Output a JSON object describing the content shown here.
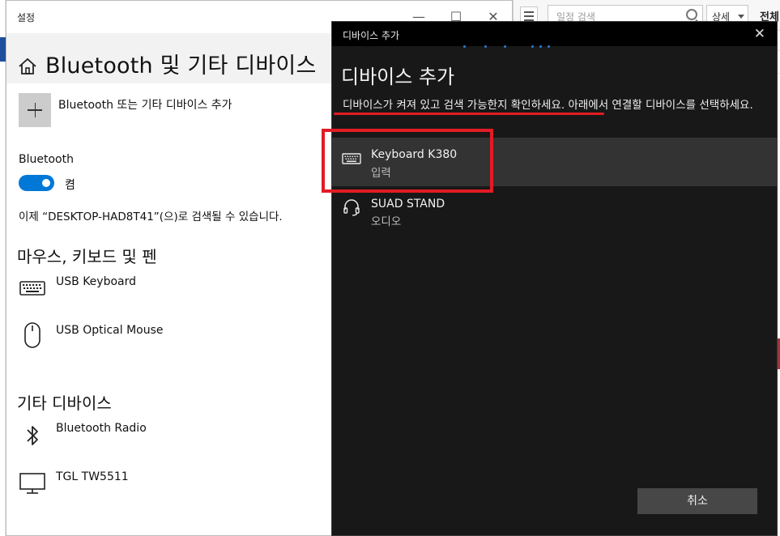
{
  "background_app": {
    "search_placeholder": "일정 검색",
    "detail_label": "상세",
    "all_label": "전체"
  },
  "settings": {
    "window_title": "설정",
    "page_title": "Bluetooth 및 기타 디바이스",
    "add_device_label": "Bluetooth 또는 기타 디바이스 추가",
    "bluetooth_heading": "Bluetooth",
    "bluetooth_state": "켬",
    "discoverable_text": "이제 “DESKTOP-HAD8T41”(으)로 검색될 수 있습니다.",
    "sections": [
      {
        "heading": "마우스, 키보드 및 펜",
        "devices": [
          {
            "name": "USB Keyboard",
            "icon": "keyboard-icon"
          },
          {
            "name": "USB Optical Mouse",
            "icon": "mouse-icon"
          }
        ]
      },
      {
        "heading": "기타 디바이스",
        "devices": [
          {
            "name": "Bluetooth Radio",
            "icon": "bluetooth-icon"
          },
          {
            "name": "TGL TW5511",
            "icon": "monitor-icon"
          }
        ]
      }
    ]
  },
  "dialog": {
    "window_title": "디바이스 추가",
    "heading": "디바이스 추가",
    "instruction": "디바이스가 켜져 있고 검색 가능한지 확인하세요. 아래에서 연결할 디바이스를 선택하세요.",
    "devices": [
      {
        "name": "Keyboard K380",
        "type": "입력",
        "icon": "keyboard-icon",
        "selected": true
      },
      {
        "name": "SUAD STAND",
        "type": "오디오",
        "icon": "headset-icon",
        "selected": false
      }
    ],
    "cancel_label": "취소"
  },
  "colors": {
    "accent": "#0078d7",
    "annotation_red": "#e21c23",
    "dialog_bg": "#181818",
    "selected_row": "#333333"
  }
}
